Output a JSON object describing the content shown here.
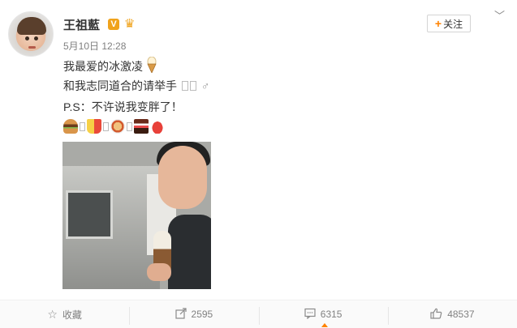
{
  "user": {
    "name": "王祖藍",
    "verified_badge": "V",
    "vip_icon": "crown-icon"
  },
  "post": {
    "time": "5月10日 12:28",
    "line1": "我最爱的冰激凌",
    "line2": "和我志同道合的请举手",
    "line2_symbol": "♂",
    "line3": "P.S：不许说我变胖了！",
    "emojis": [
      "burger-icon",
      "fries-icon",
      "noodle-icon",
      "cake-icon",
      "sushi-icon"
    ]
  },
  "actions": {
    "follow_label": "关注",
    "follow_plus": "+",
    "menu_chevron": "﹀"
  },
  "footer": {
    "favorite_label": "收藏",
    "forward_count": "2595",
    "comment_count": "6315",
    "like_count": "48537"
  },
  "colors": {
    "accent": "#ff8200",
    "badge": "#f0a31c",
    "muted": "#808080"
  }
}
